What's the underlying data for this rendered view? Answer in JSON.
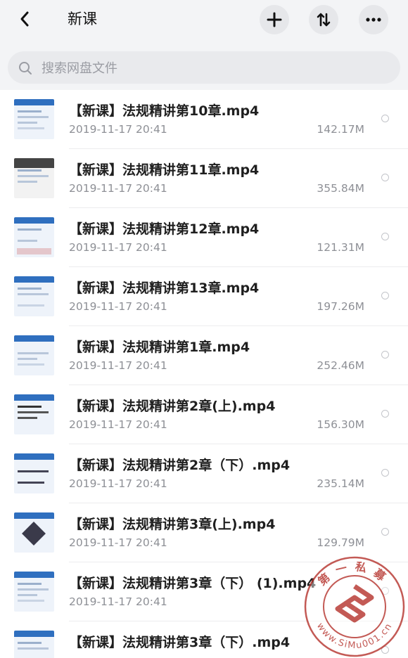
{
  "header": {
    "title": "新课",
    "back_icon": "chevron-left-icon",
    "add_icon": "plus-icon",
    "sort_icon": "sort-arrows-icon",
    "more_icon": "more-dots-icon"
  },
  "search": {
    "placeholder": "搜索网盘文件",
    "value": ""
  },
  "files": [
    {
      "name": "【新课】法规精讲第10章.mp4",
      "date": "2019-11-17 20:41",
      "size": "142.17M"
    },
    {
      "name": "【新课】法规精讲第11章.mp4",
      "date": "2019-11-17 20:41",
      "size": "355.84M"
    },
    {
      "name": "【新课】法规精讲第12章.mp4",
      "date": "2019-11-17 20:41",
      "size": "121.31M"
    },
    {
      "name": "【新课】法规精讲第13章.mp4",
      "date": "2019-11-17 20:41",
      "size": "197.26M"
    },
    {
      "name": "【新课】法规精讲第1章.mp4",
      "date": "2019-11-17 20:41",
      "size": "252.46M"
    },
    {
      "name": "【新课】法规精讲第2章(上).mp4",
      "date": "2019-11-17 20:41",
      "size": "156.30M"
    },
    {
      "name": "【新课】法规精讲第2章（下）.mp4",
      "date": "2019-11-17 20:41",
      "size": "235.14M"
    },
    {
      "name": "【新课】法规精讲第3章(上).mp4",
      "date": "2019-11-17 20:41",
      "size": "129.79M"
    },
    {
      "name": "【新课】法规精讲第3章（下） (1).mp4",
      "date": "2019-11-17 20:41",
      "size": ""
    },
    {
      "name": "【新课】法规精讲第3章（下）.mp4",
      "date": "",
      "size": ""
    }
  ],
  "watermark": {
    "text_top": "第一私募",
    "text_bottom": "www.SiMu001.cn",
    "color": "#b5312b"
  },
  "colors": {
    "background": "#f3f4f6",
    "list_bg": "#ffffff",
    "watermark": "#b5312b"
  }
}
